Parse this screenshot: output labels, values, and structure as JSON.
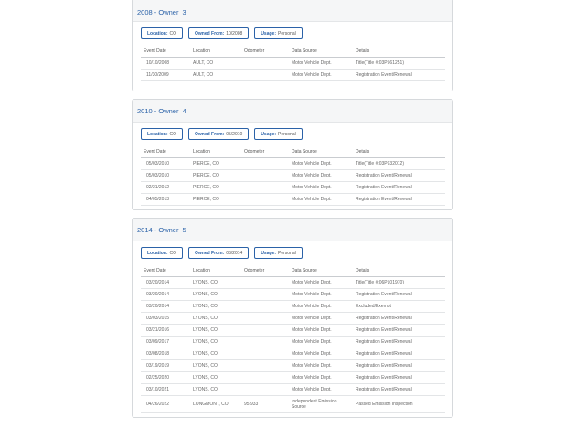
{
  "owners": [
    {
      "year": "2008",
      "owner_label": "Owner",
      "owner_num": "3",
      "location_label": "Location:",
      "location": "CO",
      "owned_from_label": "Owned From:",
      "owned_from": "10/2008",
      "usage_label": "Usage:",
      "usage": "Personal",
      "columns": [
        "Event Date",
        "Location",
        "Odometer",
        "Data Source",
        "Details"
      ],
      "rows": [
        [
          "10/10/2008",
          "AULT, CO",
          "",
          "Motor Vehicle Dept.",
          "Title(Title #:03P561251)"
        ],
        [
          "11/30/2009",
          "AULT, CO",
          "",
          "Motor Vehicle Dept.",
          "Registration Event/Renewal"
        ]
      ]
    },
    {
      "year": "2010",
      "owner_label": "Owner",
      "owner_num": "4",
      "location_label": "Location:",
      "location": "CO",
      "owned_from_label": "Owned From:",
      "owned_from": "05/2010",
      "usage_label": "Usage:",
      "usage": "Personal",
      "columns": [
        "Event Date",
        "Location",
        "Odometer",
        "Data Source",
        "Details"
      ],
      "rows": [
        [
          "05/03/2010",
          "PIERCE, CO",
          "",
          "Motor Vehicle Dept.",
          "Title(Title #:03P632012)"
        ],
        [
          "05/03/2010",
          "PIERCE, CO",
          "",
          "Motor Vehicle Dept.",
          "Registration Event/Renewal"
        ],
        [
          "02/21/2012",
          "PIERCE, CO",
          "",
          "Motor Vehicle Dept.",
          "Registration Event/Renewal"
        ],
        [
          "04/05/2013",
          "PIERCE, CO",
          "",
          "Motor Vehicle Dept.",
          "Registration Event/Renewal"
        ]
      ]
    },
    {
      "year": "2014",
      "owner_label": "Owner",
      "owner_num": "5",
      "location_label": "Location:",
      "location": "CO",
      "owned_from_label": "Owned From:",
      "owned_from": "03/2014",
      "usage_label": "Usage:",
      "usage": "Personal",
      "columns": [
        "Event Date",
        "Location",
        "Odometer",
        "Data Source",
        "Details"
      ],
      "rows": [
        [
          "03/20/2014",
          "LYONS, CO",
          "",
          "Motor Vehicle Dept.",
          "Title(Title #:06P101970)"
        ],
        [
          "03/20/2014",
          "LYONS, CO",
          "",
          "Motor Vehicle Dept.",
          "Registration Event/Renewal"
        ],
        [
          "03/20/2014",
          "LYONS, CO",
          "",
          "Motor Vehicle Dept.",
          "Excluded/Exempt"
        ],
        [
          "03/03/2015",
          "LYONS, CO",
          "",
          "Motor Vehicle Dept.",
          "Registration Event/Renewal"
        ],
        [
          "03/21/2016",
          "LYONS, CO",
          "",
          "Motor Vehicle Dept.",
          "Registration Event/Renewal"
        ],
        [
          "03/09/2017",
          "LYONS, CO",
          "",
          "Motor Vehicle Dept.",
          "Registration Event/Renewal"
        ],
        [
          "03/08/2018",
          "LYONS, CO",
          "",
          "Motor Vehicle Dept.",
          "Registration Event/Renewal"
        ],
        [
          "03/19/2019",
          "LYONS, CO",
          "",
          "Motor Vehicle Dept.",
          "Registration Event/Renewal"
        ],
        [
          "02/25/2020",
          "LYONS, CO",
          "",
          "Motor Vehicle Dept.",
          "Registration Event/Renewal"
        ],
        [
          "03/10/2021",
          "LYONS, CO",
          "",
          "Motor Vehicle Dept.",
          "Registration Event/Renewal"
        ],
        [
          "04/26/2022",
          "LONGMONT, CO",
          "95,933",
          "Independent Emission Source",
          "Passed Emission Inspection"
        ]
      ]
    }
  ]
}
